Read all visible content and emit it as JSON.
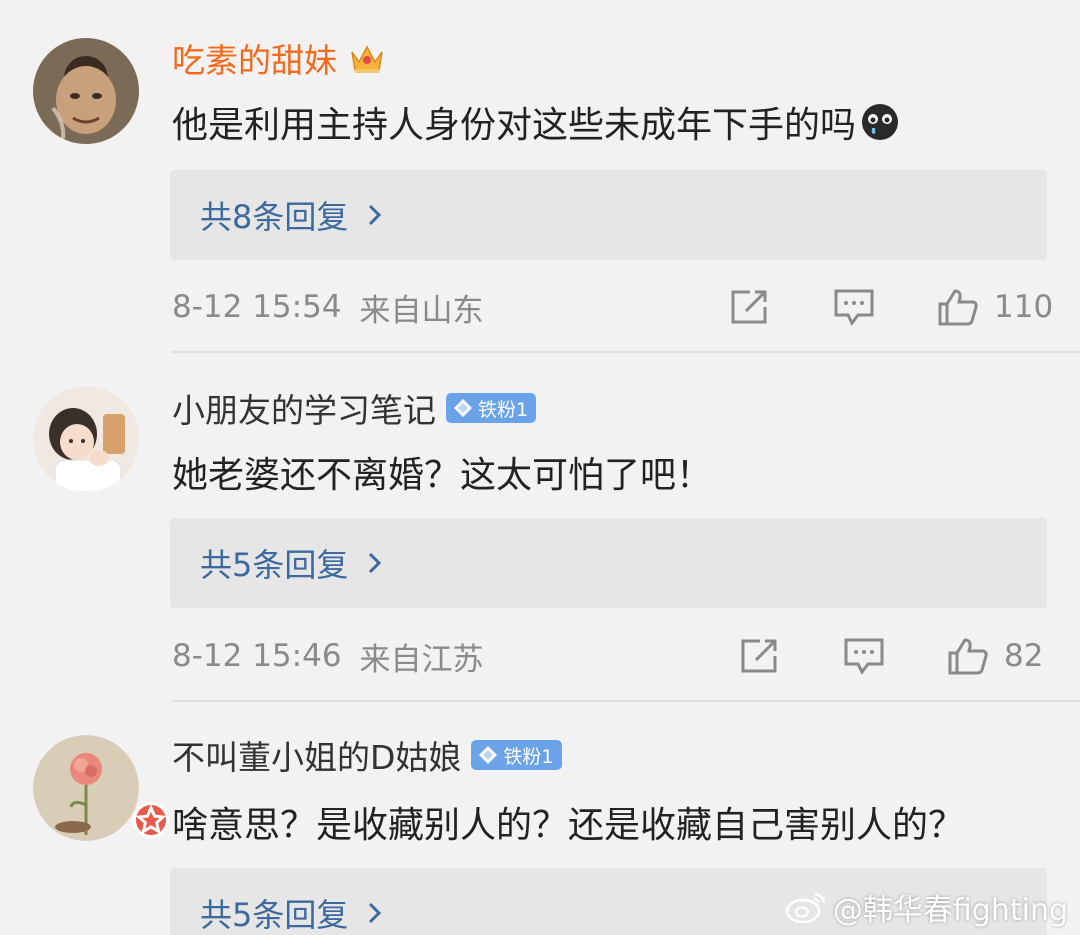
{
  "comments": [
    {
      "username": "吃素的甜妹",
      "badge": "",
      "text": "他是利用主持人身份对这些未成年下手的吗",
      "reply_link": "共8条回复",
      "time": "8-12 15:54",
      "location": "来自山东",
      "likes": "110"
    },
    {
      "username": "小朋友的学习笔记",
      "badge": "铁粉1",
      "text": "她老婆还不离婚？这太可怕了吧！",
      "reply_link": "共5条回复",
      "time": "8-12 15:46",
      "location": "来自江苏",
      "likes": "82"
    },
    {
      "username": "不叫董小姐的D姑娘",
      "badge": "铁粉1",
      "text": "啥意思？是收藏别人的？还是收藏自己害别人的？",
      "reply_link": "共5条回复"
    }
  ],
  "watermark": "@韩华春fighting",
  "colors": {
    "vip_name": "#f26b1d",
    "link": "#3d6a9e",
    "meta": "#8a8a8a",
    "fan_badge": "#6aa3e8"
  }
}
